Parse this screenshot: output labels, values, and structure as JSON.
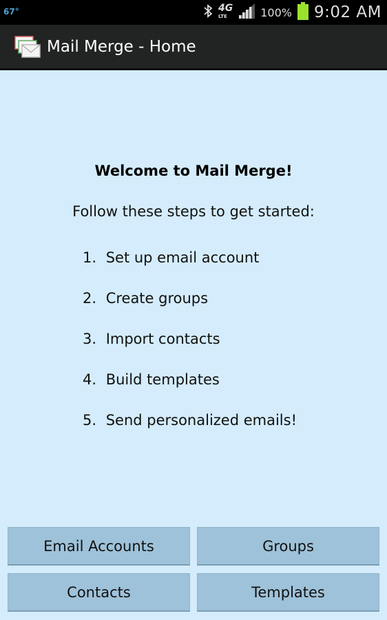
{
  "status_bar": {
    "temperature": "67°",
    "network": "4G",
    "network_sub": "LTE",
    "battery_percent": "100%",
    "time": "9:02 AM"
  },
  "action_bar": {
    "title": "Mail Merge - Home"
  },
  "welcome": {
    "heading": "Welcome to Mail Merge!",
    "subtitle": "Follow these steps to get started:",
    "steps": [
      {
        "num": "1.",
        "text": "Set up email account"
      },
      {
        "num": "2.",
        "text": "Create groups"
      },
      {
        "num": "3.",
        "text": "Import contacts"
      },
      {
        "num": "4.",
        "text": "Build templates"
      },
      {
        "num": "5.",
        "text": "Send personalized emails!"
      }
    ]
  },
  "buttons": {
    "email_accounts": "Email Accounts",
    "groups": "Groups",
    "contacts": "Contacts",
    "templates": "Templates"
  },
  "icons": [
    "bluetooth-icon",
    "signal-icon",
    "battery-icon",
    "app-envelopes-icon"
  ],
  "colors": {
    "background": "#d4ecfb",
    "button": "#9ec2d9",
    "action_bar": "#222323",
    "battery": "#9be22e"
  }
}
